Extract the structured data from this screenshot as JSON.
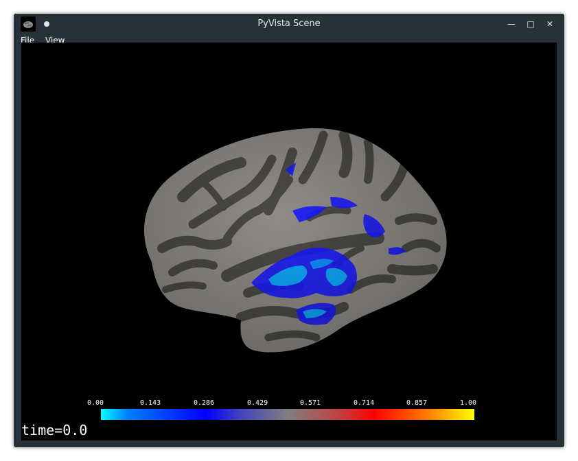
{
  "window": {
    "title": "PyVista Scene",
    "minimize_glyph": "—",
    "maximize_glyph": "□",
    "close_glyph": "✕"
  },
  "menubar": {
    "items": [
      "File",
      "View"
    ]
  },
  "scene": {
    "colorbar": {
      "ticks": [
        "0.00",
        "0.143",
        "0.286",
        "0.429",
        "0.571",
        "0.714",
        "0.857",
        "1.00"
      ],
      "colors": [
        "#00ffff",
        "#0000ff",
        "#808080",
        "#ff0000",
        "#ffff00"
      ]
    },
    "time_label": "time=0.0"
  },
  "colors": {
    "window_frame": "#263238",
    "viewport_background": "#000000",
    "cortex_gyri": "#8f8c88",
    "cortex_sulci": "#4a4947",
    "activation_low": "#0000ee",
    "activation_high": "#00ffff"
  }
}
